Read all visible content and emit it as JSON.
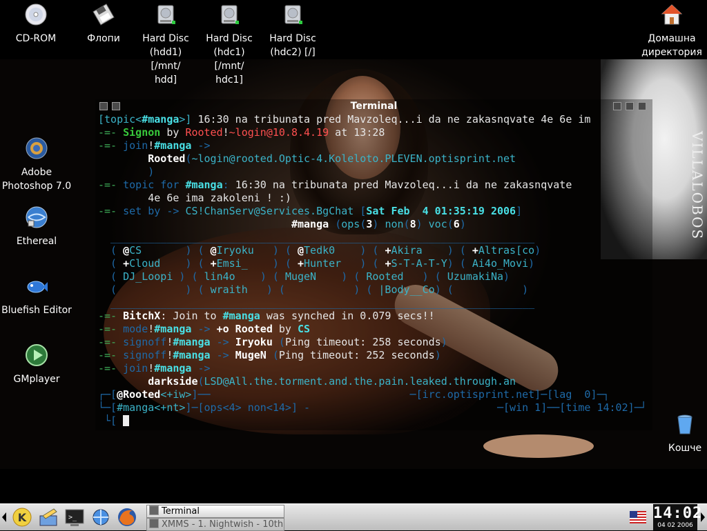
{
  "desktop_icons_top": [
    {
      "name": "cdrom",
      "lines": [
        "CD-ROM"
      ]
    },
    {
      "name": "floppy",
      "lines": [
        "Флопи"
      ]
    },
    {
      "name": "hdd1",
      "lines": [
        "Hard Disc",
        "(hdd1) [/mnt/",
        "hdd]"
      ]
    },
    {
      "name": "hdc1",
      "lines": [
        "Hard Disc",
        "(hdc1) [/mnt/",
        "hdc1]"
      ]
    },
    {
      "name": "hdc2",
      "lines": [
        "Hard Disc",
        "(hdc2) [/]"
      ]
    },
    {
      "name": "home",
      "lines": [
        "Домашна",
        "директория"
      ]
    }
  ],
  "desktop_icons_left": [
    {
      "name": "photoshop",
      "lines": [
        "Adobe",
        "Photoshop 7.0"
      ]
    },
    {
      "name": "ethereal",
      "lines": [
        "Ethereal"
      ]
    },
    {
      "name": "bluefish",
      "lines": [
        "Bluefish Editor"
      ]
    },
    {
      "name": "gmplayer",
      "lines": [
        "GMplayer"
      ]
    }
  ],
  "trash": {
    "lines": [
      "Кошче"
    ]
  },
  "wallpaper": {
    "text": "VILLALOBOS"
  },
  "terminal": {
    "title": "Terminal",
    "lines": [
      [
        [
          "c",
          "[topic<"
        ],
        [
          "cy b",
          "#manga"
        ],
        [
          "c",
          ">] "
        ],
        [
          "w",
          "16:30 na tribunata pred Mavzoleq...i da ne zakasnqvate 4e 6e im"
        ]
      ],
      [
        [
          "g",
          "-=- "
        ],
        [
          "gr b",
          "Signon"
        ],
        [
          "w",
          " by "
        ],
        [
          "r",
          "Rooted"
        ],
        [
          "w",
          "!"
        ],
        [
          "r",
          "~login@10.8.4.19"
        ],
        [
          "w",
          " at 13:28"
        ]
      ],
      [
        [
          "g",
          "-=- "
        ],
        [
          "db",
          "join"
        ],
        [
          "w",
          "!"
        ],
        [
          "cy b",
          "#manga"
        ],
        [
          "db",
          " ->"
        ]
      ],
      [
        [
          "w",
          "        "
        ],
        [
          "wb",
          "Rooted"
        ],
        [
          "db",
          "("
        ],
        [
          "c",
          "~login@rooted.Optic-4.Koleloto.PLEVEN.optisprint.net"
        ]
      ],
      [
        [
          "db",
          "        )"
        ]
      ],
      [
        [
          "g",
          "-=- "
        ],
        [
          "db",
          "topic for "
        ],
        [
          "cy b",
          "#manga"
        ],
        [
          "db",
          ": "
        ],
        [
          "w",
          "16:30 na tribunata pred Mavzoleq...i da ne zakasnqvate"
        ]
      ],
      [
        [
          "w",
          "        4e 6e ima zakoleni ! :)"
        ]
      ],
      [
        [
          "g",
          "-=- "
        ],
        [
          "db",
          "set by "
        ],
        [
          "db",
          "-> "
        ],
        [
          "c",
          "CS!ChanServ@Services.BgChat "
        ],
        [
          "db",
          "["
        ],
        [
          "cy b",
          "Sat Feb  4 01:35:19 2006"
        ],
        [
          "db",
          "]"
        ]
      ],
      [
        [
          "w",
          "                               "
        ],
        [
          "wb",
          "#manga "
        ],
        [
          "db",
          "("
        ],
        [
          "c",
          "ops"
        ],
        [
          "db",
          "("
        ],
        [
          "wb",
          "3"
        ],
        [
          "db",
          ") "
        ],
        [
          "c",
          "non"
        ],
        [
          "db",
          "("
        ],
        [
          "wb",
          "8"
        ],
        [
          "db",
          ") "
        ],
        [
          "c",
          "voc"
        ],
        [
          "db",
          "("
        ],
        [
          "wb",
          "6"
        ],
        [
          "db",
          ")"
        ]
      ],
      [
        [
          "db",
          "  ____________________________________________________________________"
        ]
      ],
      [
        [
          "db",
          "  ( "
        ],
        [
          "wb",
          "@"
        ],
        [
          "c",
          "CS       "
        ],
        [
          "db",
          ") ( "
        ],
        [
          "wb",
          "@"
        ],
        [
          "c",
          "Iryoku   "
        ],
        [
          "db",
          ") ( "
        ],
        [
          "wb",
          "@"
        ],
        [
          "c",
          "Tedk0    "
        ],
        [
          "db",
          ") ( "
        ],
        [
          "wb",
          "+"
        ],
        [
          "c",
          "Akira    "
        ],
        [
          "db",
          ") ( "
        ],
        [
          "wb",
          "+"
        ],
        [
          "c",
          "Altras[co"
        ],
        [
          "db",
          ")"
        ]
      ],
      [
        [
          "db",
          "  ( "
        ],
        [
          "wb",
          "+"
        ],
        [
          "c",
          "Cloud    "
        ],
        [
          "db",
          ") ( "
        ],
        [
          "wb",
          "+"
        ],
        [
          "c",
          "Emsi_    "
        ],
        [
          "db",
          ") ( "
        ],
        [
          "wb",
          "+"
        ],
        [
          "c",
          "Hunter   "
        ],
        [
          "db",
          ") ( "
        ],
        [
          "wb",
          "+"
        ],
        [
          "c",
          "S-T-A-T-Y"
        ],
        [
          "db",
          ") ( "
        ],
        [
          "c",
          "Ai4o_Movi"
        ],
        [
          "db",
          ")"
        ]
      ],
      [
        [
          "db",
          "  ( "
        ],
        [
          "c",
          "DJ_Loopi "
        ],
        [
          "db",
          ") ( "
        ],
        [
          "c",
          "lin4o    "
        ],
        [
          "db",
          ") ( "
        ],
        [
          "c",
          "MugeN    "
        ],
        [
          "db",
          ") ( "
        ],
        [
          "c",
          "Rooted   "
        ],
        [
          "db",
          ") ( "
        ],
        [
          "c",
          "UzumakiNa"
        ],
        [
          "db",
          ")"
        ]
      ],
      [
        [
          "db",
          "  (           ) ( "
        ],
        [
          "c",
          "wraith   "
        ],
        [
          "db",
          ") (           ) ( "
        ],
        [
          "c",
          "|Body__Co"
        ],
        [
          "db",
          ") (           )"
        ]
      ],
      [
        [
          "db",
          "  ____________________________________________________________________"
        ]
      ],
      [
        [
          "g",
          "-=- "
        ],
        [
          "wb",
          "BitchX"
        ],
        [
          "w",
          ": Join to "
        ],
        [
          "cy b",
          "#manga"
        ],
        [
          "w",
          " was synched in 0.079 secs!!"
        ]
      ],
      [
        [
          "g",
          "-=- "
        ],
        [
          "db",
          "mode"
        ],
        [
          "w",
          "!"
        ],
        [
          "cy b",
          "#manga"
        ],
        [
          "db",
          " -> "
        ],
        [
          "wb",
          "+o Rooted"
        ],
        [
          "w",
          " by "
        ],
        [
          "cy b",
          "CS"
        ]
      ],
      [
        [
          "g",
          "-=- "
        ],
        [
          "db",
          "signoff"
        ],
        [
          "w",
          "!"
        ],
        [
          "cy b",
          "#manga"
        ],
        [
          "db",
          " -> "
        ],
        [
          "wb",
          "Iryoku"
        ],
        [
          "db",
          " ("
        ],
        [
          "w",
          "Ping timeout: 258 seconds"
        ],
        [
          "db",
          ")"
        ]
      ],
      [
        [
          "g",
          "-=- "
        ],
        [
          "db",
          "signoff"
        ],
        [
          "w",
          "!"
        ],
        [
          "cy b",
          "#manga"
        ],
        [
          "db",
          " -> "
        ],
        [
          "wb",
          "MugeN"
        ],
        [
          "db",
          " ("
        ],
        [
          "w",
          "Ping timeout: 252 seconds"
        ],
        [
          "db",
          ")"
        ]
      ],
      [
        [
          "g",
          "-=- "
        ],
        [
          "db",
          "join"
        ],
        [
          "w",
          "!"
        ],
        [
          "cy b",
          "#manga"
        ],
        [
          "db",
          " ->"
        ]
      ],
      [
        [
          "w",
          "        "
        ],
        [
          "wb",
          "darkside"
        ],
        [
          "db",
          "("
        ],
        [
          "c",
          "LSD@All.the.torment.and.the.pain.leaked.through.an"
        ]
      ],
      [
        [
          "db",
          "┌─["
        ],
        [
          "wb",
          "@Rooted"
        ],
        [
          "c",
          "<+iw>"
        ],
        [
          "db",
          "]──                                ─[irc.optisprint.net]─[lag  0]─┐"
        ]
      ],
      [
        [
          "db",
          "└─["
        ],
        [
          "c",
          "#manga<+nt>"
        ],
        [
          "db",
          "]─[ops<4> non<14>] -                              ─[win 1]──[time 14:02]─┘"
        ]
      ],
      [
        [
          "db",
          " └["
        ]
      ]
    ]
  },
  "taskbar": {
    "tasks": [
      {
        "label": "Terminal",
        "active": true
      },
      {
        "label": "XMMS - 1. Nightwish - 10th",
        "active": false
      }
    ],
    "clock": {
      "time": "14:02",
      "date": "04 02 2006"
    },
    "quick_launch": [
      "kde-menu-icon",
      "kate-editor-icon",
      "konsole-icon",
      "network-icon",
      "firefox-icon"
    ]
  }
}
